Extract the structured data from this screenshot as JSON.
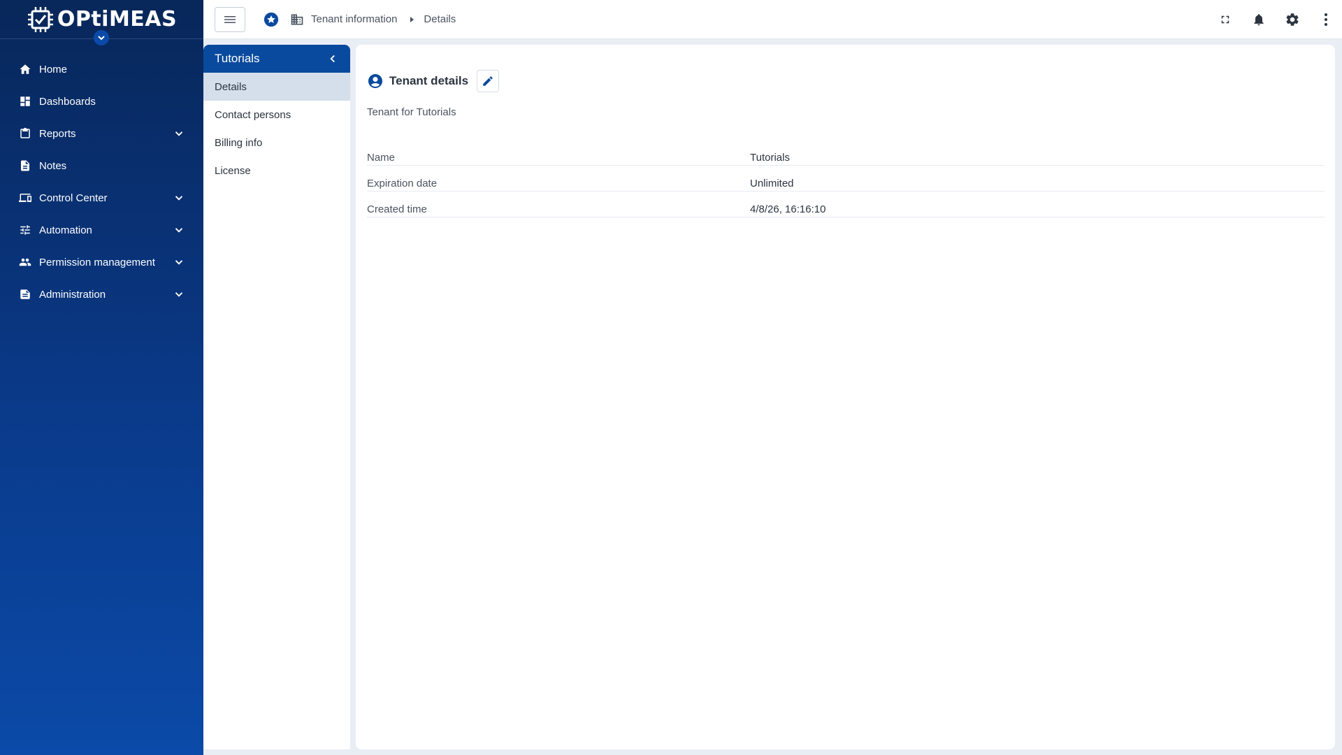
{
  "app": {
    "logo_text": "OPtiMEAS"
  },
  "sidebar": {
    "items": [
      {
        "label": "Home",
        "icon": "home-icon",
        "expandable": false
      },
      {
        "label": "Dashboards",
        "icon": "dashboard-icon",
        "expandable": false
      },
      {
        "label": "Reports",
        "icon": "clipboard-icon",
        "expandable": true
      },
      {
        "label": "Notes",
        "icon": "note-icon",
        "expandable": false
      },
      {
        "label": "Control Center",
        "icon": "devices-icon",
        "expandable": true
      },
      {
        "label": "Automation",
        "icon": "sliders-icon",
        "expandable": true
      },
      {
        "label": "Permission management",
        "icon": "people-icon",
        "expandable": true
      },
      {
        "label": "Administration",
        "icon": "admin-doc-icon",
        "expandable": true
      }
    ]
  },
  "topbar": {
    "breadcrumb": {
      "section": "Tenant information",
      "current": "Details"
    }
  },
  "subpanel": {
    "title": "Tutorials",
    "items": [
      {
        "label": "Details",
        "active": true
      },
      {
        "label": "Contact persons",
        "active": false
      },
      {
        "label": "Billing info",
        "active": false
      },
      {
        "label": "License",
        "active": false
      }
    ]
  },
  "card": {
    "title": "Tenant details",
    "subtitle": "Tenant for Tutorials",
    "rows": [
      {
        "label": "Name",
        "value": "Tutorials"
      },
      {
        "label": "Expiration date",
        "value": "Unlimited"
      },
      {
        "label": "Created time",
        "value": "4/8/26, 16:16:10"
      }
    ]
  },
  "colors": {
    "primary": "#0a4a9e",
    "sidebar_top": "#08275a",
    "sidebar_bottom": "#0b4aa8",
    "active_item_bg": "#d5deeb"
  }
}
